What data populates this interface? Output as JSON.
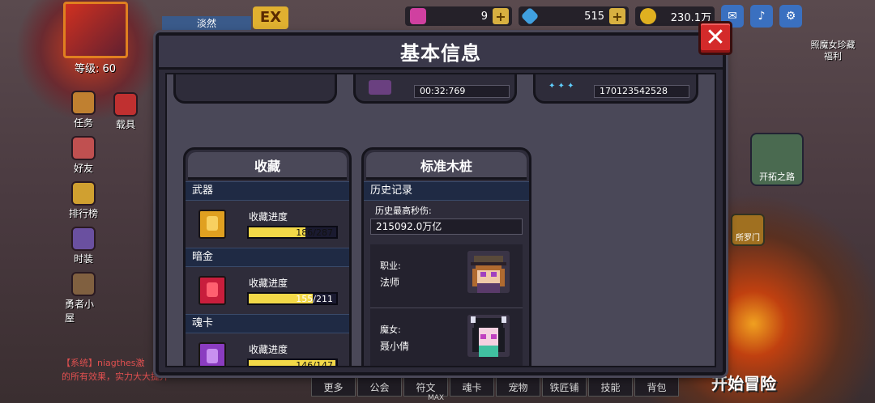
{
  "hud": {
    "player_name": "淡然",
    "level": "等级: 60",
    "ex_badge": "EX",
    "resources": [
      {
        "icon": "heart-gem-icon",
        "value": "9"
      },
      {
        "icon": "diamond-icon",
        "value": "515"
      },
      {
        "icon": "gold-coin-icon",
        "value": "230.1万"
      }
    ],
    "left_menu": [
      "任务",
      "载具",
      "好友",
      "排行榜",
      "时装",
      "勇者小屋"
    ],
    "right_menu": [
      "照魔女珍藏",
      "福利",
      "开拓之路",
      "所罗门"
    ],
    "chat_line1": "【系统】niagthes激",
    "chat_line2": "的所有效果，实力大大提升",
    "bottom_tabs": [
      "更多",
      "公会",
      "符文",
      "魂卡",
      "宠物",
      "铁匠铺",
      "技能",
      "背包"
    ],
    "max_label": "MAX",
    "start_button": "开始冒险"
  },
  "dialog": {
    "title": "基本信息",
    "close_label": "✕",
    "top_partial": {
      "time_value": "00:32:769",
      "id_value": "170123542528"
    },
    "collection": {
      "title": "收藏",
      "sections": [
        {
          "name": "武器",
          "label": "收藏进度",
          "progress": "186/287",
          "fraction": 0.648,
          "color": "#e0a020"
        },
        {
          "name": "暗金",
          "label": "收藏进度",
          "progress": "155/211",
          "fraction": 0.735,
          "color": "#d02040"
        },
        {
          "name": "魂卡",
          "label": "收藏进度",
          "progress": "146/147",
          "fraction": 0.993,
          "color": "#9040c0"
        }
      ]
    },
    "dummy": {
      "title": "标准木桩",
      "history_header": "历史记录",
      "best_dps_label": "历史最高秒伤:",
      "best_dps_value": "215092.0万亿",
      "job_label": "职业:",
      "job_value": "法师",
      "witch_label": "魔女:",
      "witch_value": "聂小倩"
    }
  }
}
